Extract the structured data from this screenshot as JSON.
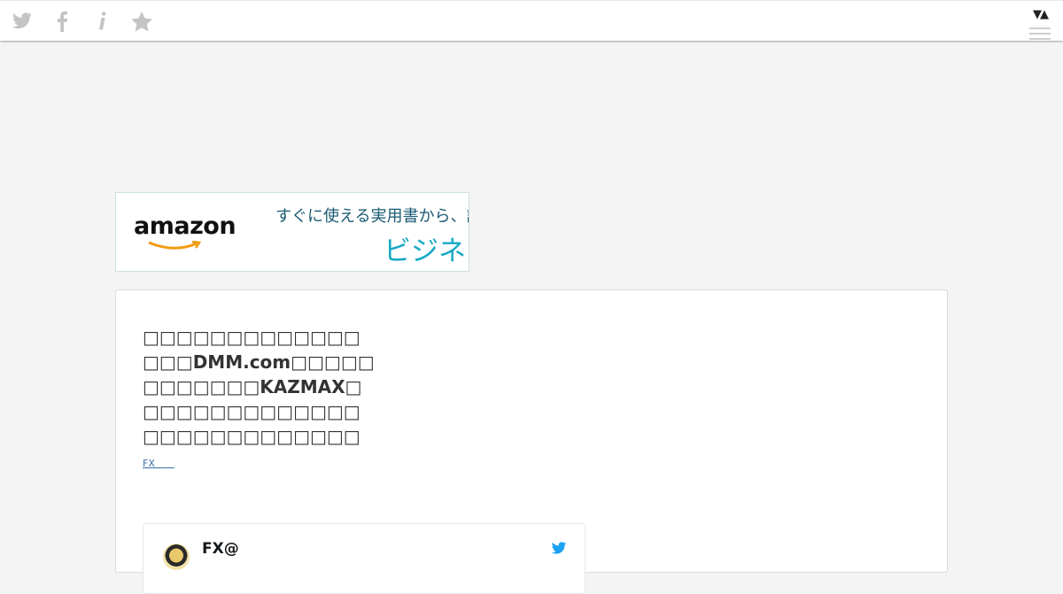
{
  "toolbar": {
    "icons": [
      "twitter-icon",
      "facebook-icon",
      "info-icon",
      "star-icon"
    ],
    "arrows": "▼▲"
  },
  "ad": {
    "logo": "amazon",
    "line1": "すぐに使える実用書から、話",
    "line2": "ビジネス"
  },
  "entry": {
    "title": "□□□□□□□□□□□□□□□□DMM.com□□□□□□□□□□□□KAZMAX□□□□□□□□□□□□□□□□□□□□□□□□□□□",
    "category": "FX　　"
  },
  "embed": {
    "handle": "FX@"
  },
  "colors": {
    "background": "#f4f4f4",
    "twitter_blue": "#1da1f2",
    "ad_accent": "#17a9c4"
  }
}
